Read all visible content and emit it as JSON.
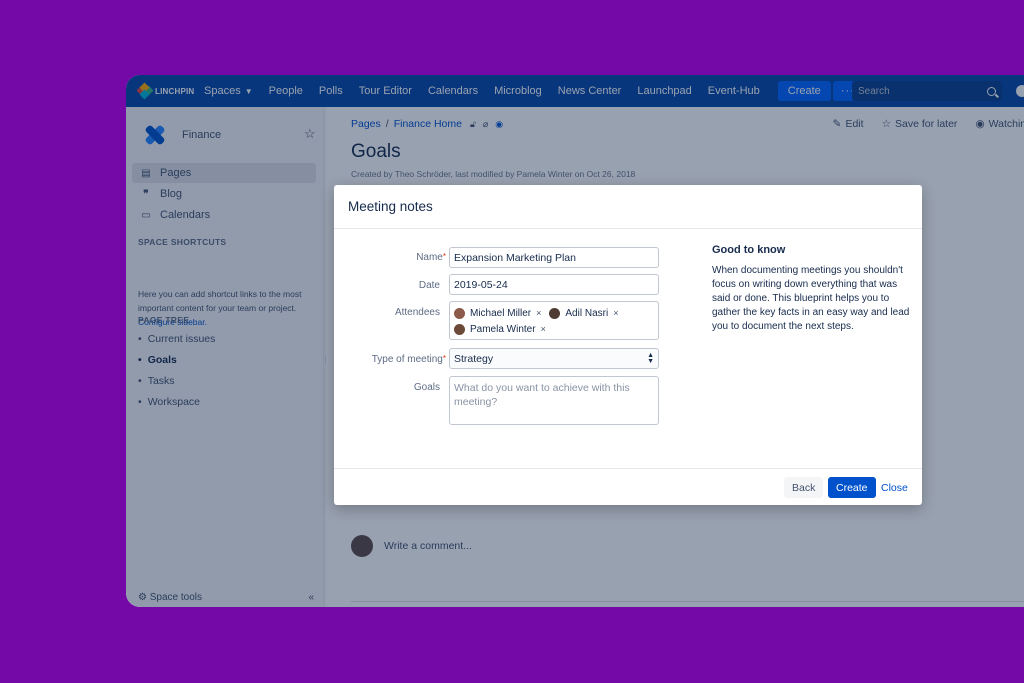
{
  "colors": {
    "background": "#7409a8",
    "nav": "#0747a6",
    "accent": "#0052cc",
    "create_button": "#0065ff",
    "space_logo": "#2684ff"
  },
  "topnav": {
    "logo_text": "LINCHPIN",
    "items": [
      "Spaces",
      "People",
      "Polls",
      "Tour Editor",
      "Calendars",
      "Microblog",
      "News Center",
      "Launchpad",
      "Event-Hub"
    ],
    "create_label": "Create",
    "more_label": "···",
    "search_placeholder": "Search"
  },
  "sidebar": {
    "space_name": "Finance",
    "links": [
      {
        "label": "Pages",
        "icon": "page-icon"
      },
      {
        "label": "Blog",
        "icon": "quote-icon"
      },
      {
        "label": "Calendars",
        "icon": "calendar-icon"
      }
    ],
    "shortcuts_title": "SPACE SHORTCUTS",
    "shortcuts_text": "Here you can add shortcut links to the most important content for your team or project.",
    "configure_link": "Configure sidebar.",
    "tree_title": "PAGE TREE",
    "tree": [
      "Current issues",
      "Goals",
      "Tasks",
      "Workspace"
    ],
    "space_tools": "Space tools",
    "collapse_glyph": "«"
  },
  "page": {
    "breadcrumb": [
      "Pages",
      "Finance Home"
    ],
    "actions": {
      "edit": "Edit",
      "save": "Save for later",
      "watch": "Watching"
    },
    "title": "Goals",
    "byline": "Created by Theo Schröder, last modified by Pamela Winter on Oct 26, 2018",
    "comment_placeholder": "Write a comment..."
  },
  "modal": {
    "title": "Meeting notes",
    "fields": {
      "name_label": "Name",
      "name_value": "Expansion Marketing Plan",
      "date_label": "Date",
      "date_value": "2019-05-24",
      "attendees_label": "Attendees",
      "attendees": [
        "Michael Miller",
        "Adil Nasri",
        "Pamela Winter"
      ],
      "type_label": "Type of meeting",
      "type_value": "Strategy",
      "goals_label": "Goals",
      "goals_placeholder": "What do you want to achieve with this meeting?"
    },
    "help_title": "Good to know",
    "help_body": "When documenting meetings you shouldn't focus on writing down everything that was said or done. This blueprint helps you to gather the key facts in an easy way and lead you to document the next steps.",
    "buttons": {
      "back": "Back",
      "create": "Create",
      "close": "Close"
    }
  }
}
